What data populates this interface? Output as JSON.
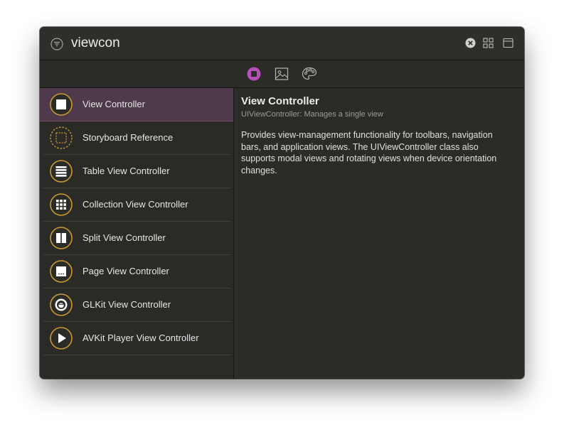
{
  "colors": {
    "accent": "#b64fb7",
    "icon_gold": "#c99a2e",
    "selected_row": "#4e3a4b"
  },
  "search": {
    "value": "viewcon",
    "filter_icon": "filter-icon",
    "clear_icon": "clear-icon",
    "grid_icon": "grid-view-icon",
    "detail_icon": "detail-view-icon"
  },
  "library_tabs": [
    {
      "name": "objects",
      "icon": "stop-icon",
      "active": true
    },
    {
      "name": "media",
      "icon": "image-icon",
      "active": false
    },
    {
      "name": "colors",
      "icon": "palette-icon",
      "active": false
    }
  ],
  "items": [
    {
      "label": "View Controller",
      "icon": "view-controller-icon",
      "selected": true
    },
    {
      "label": "Storyboard Reference",
      "icon": "storyboard-reference-icon",
      "selected": false
    },
    {
      "label": "Table View Controller",
      "icon": "table-view-icon",
      "selected": false
    },
    {
      "label": "Collection View Controller",
      "icon": "collection-view-icon",
      "selected": false
    },
    {
      "label": "Split View Controller",
      "icon": "split-view-icon",
      "selected": false
    },
    {
      "label": "Page View Controller",
      "icon": "page-view-icon",
      "selected": false
    },
    {
      "label": "GLKit View Controller",
      "icon": "glkit-icon",
      "selected": false
    },
    {
      "label": "AVKit Player View Controller",
      "icon": "play-icon",
      "selected": false
    }
  ],
  "detail": {
    "title": "View Controller",
    "subtitle": "UIViewController: Manages a single view",
    "description": "Provides view-management functionality for toolbars, navigation bars, and application views. The UIViewController class also supports modal views and rotating views when device orientation changes."
  }
}
